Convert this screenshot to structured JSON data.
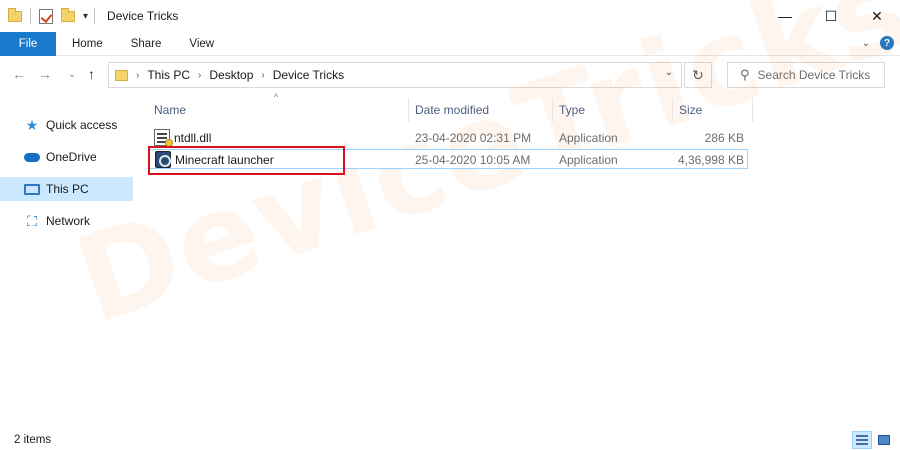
{
  "window": {
    "title": "Device Tricks",
    "controls": {
      "minimize": "—",
      "maximize": "☐",
      "close": "✕"
    }
  },
  "ribbon": {
    "tabs": [
      {
        "label": "File"
      },
      {
        "label": "Home"
      },
      {
        "label": "Share"
      },
      {
        "label": "View"
      }
    ],
    "help_glyph": "?"
  },
  "address": {
    "breadcrumbs": [
      "This PC",
      "Desktop",
      "Device Tricks"
    ],
    "search_placeholder": "Search Device Tricks"
  },
  "sidebar": {
    "items": [
      {
        "label": "Quick access",
        "icon": "star-icon",
        "selected": false
      },
      {
        "label": "OneDrive",
        "icon": "cloud-icon",
        "selected": false
      },
      {
        "label": "This PC",
        "icon": "computer-icon",
        "selected": true
      },
      {
        "label": "Network",
        "icon": "network-icon",
        "selected": false
      }
    ]
  },
  "columns": {
    "name": "Name",
    "date_modified": "Date modified",
    "type": "Type",
    "size": "Size"
  },
  "files": [
    {
      "name": "ntdll.dll",
      "date_modified": "23-04-2020 02:31 PM",
      "type": "Application",
      "size": "286 KB",
      "icon": "dll-file-icon"
    },
    {
      "name": "Minecraft launcher",
      "date_modified": "25-04-2020 10:05 AM",
      "type": "Application",
      "size": "4,36,998 KB",
      "icon": "minecraft-app-icon"
    }
  ],
  "watermark": "DeviceTricks",
  "status": {
    "item_count": "2 items"
  },
  "colors": {
    "accent": "#1979ca",
    "selection": "#cce8ff",
    "highlight_box": "#d9101d"
  }
}
